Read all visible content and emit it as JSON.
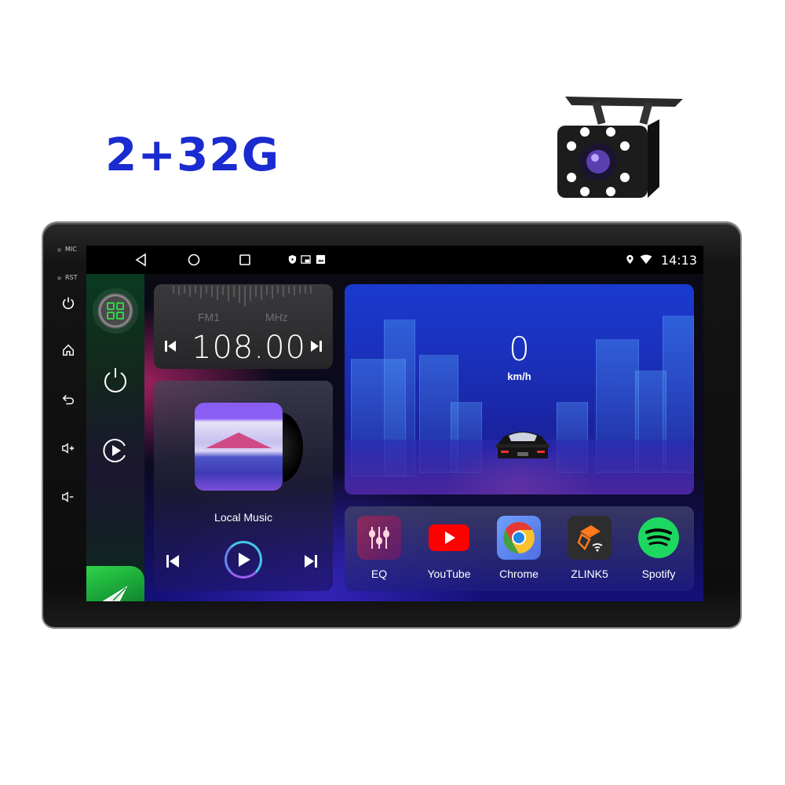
{
  "product": {
    "spec_label": "2+32G",
    "accessory": "backup-camera"
  },
  "hardware": {
    "labels": [
      "MIC",
      "RST"
    ],
    "buttons": [
      "power",
      "home",
      "back",
      "volume-up",
      "volume-down"
    ]
  },
  "statusbar": {
    "nav": [
      "back",
      "home",
      "recents"
    ],
    "notification_icons": [
      "shield-play",
      "cast",
      "image"
    ],
    "indicators": [
      "location",
      "wifi"
    ],
    "time": "14:13"
  },
  "sidebar": {
    "items": [
      "apps",
      "power",
      "play",
      "navigation"
    ]
  },
  "radio": {
    "band": "FM1",
    "unit": "MHz",
    "frequency": "108.00"
  },
  "music": {
    "title": "Local Music"
  },
  "speedometer": {
    "value": "0",
    "unit": "km/h"
  },
  "dock": {
    "apps": [
      {
        "label": "EQ",
        "color": "#8b2a5a"
      },
      {
        "label": "YouTube",
        "color": "#ff0000"
      },
      {
        "label": "Chrome",
        "color": "#5b8df0"
      },
      {
        "label": "ZLINK5",
        "color": "#2d2d2d"
      },
      {
        "label": "Spotify",
        "color": "#1ed760"
      }
    ]
  }
}
